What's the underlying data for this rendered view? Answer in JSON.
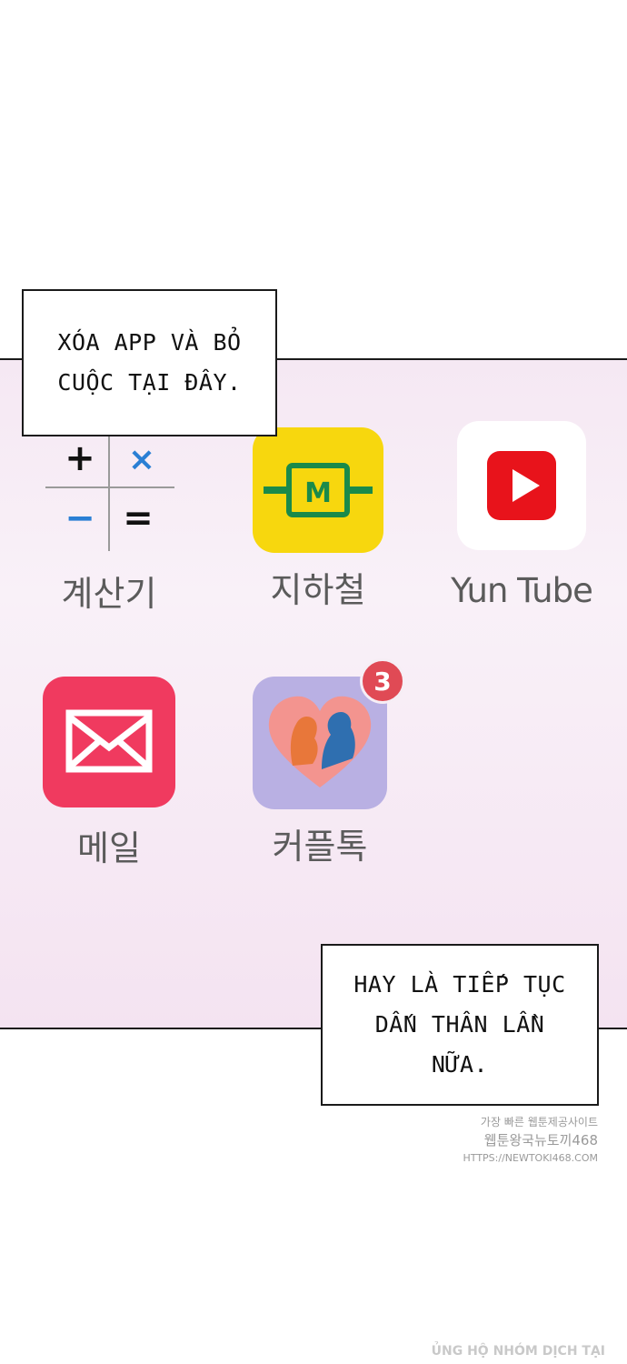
{
  "captions": {
    "top": "XÓA APP VÀ BỎ\nCUỘC TẠI ĐÂY.",
    "bottom": "HAY LÀ TIẾP TỤC\nDẤN THÂN LẦN\nNỮA."
  },
  "apps": {
    "calculator": {
      "label": "계산기",
      "symbols": [
        "+",
        "×",
        "−",
        "="
      ]
    },
    "subway": {
      "label": "지하철",
      "logo_text": "M",
      "color": "#f7d70e"
    },
    "yuntube": {
      "label": "Yun Tube",
      "color": "#e8131b"
    },
    "mail": {
      "label": "메일",
      "color": "#f03a5f"
    },
    "coupletalk": {
      "label": "커플톡",
      "badge": "3",
      "color": "#b9b0e3"
    }
  },
  "watermark": {
    "line1": "가장 빠른 웹툰제공사이트",
    "line2": "웹툰왕국뉴토끼468",
    "line3": "HTTPS://NEWTOKI468.COM"
  },
  "credit": "ỦNG HỘ NHÓM DỊCH TẠI"
}
